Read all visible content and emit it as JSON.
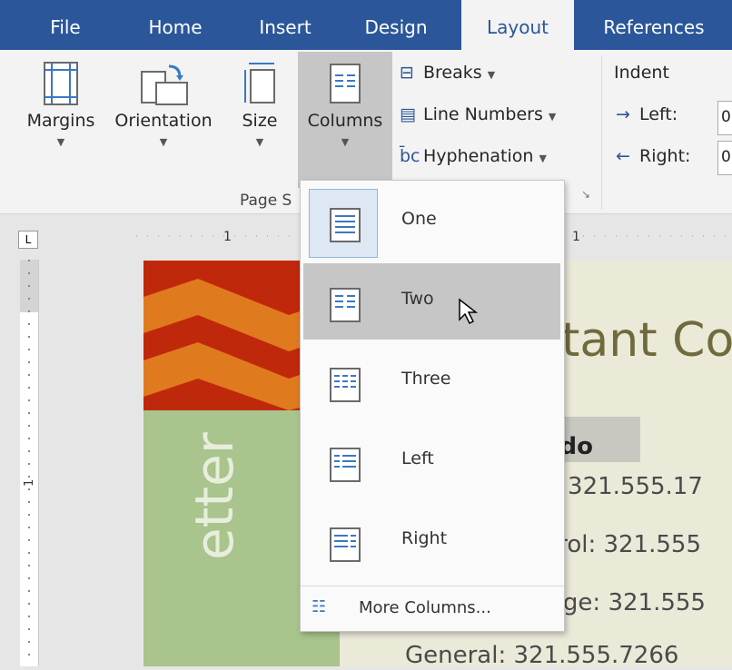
{
  "tabs": [
    "File",
    "Home",
    "Insert",
    "Design",
    "Layout",
    "References"
  ],
  "ribbon": {
    "margins": "Margins",
    "orientation": "Orientation",
    "size": "Size",
    "columns": "Columns",
    "breaks": "Breaks",
    "line_numbers": "Line Numbers",
    "hyphenation": "Hyphenation",
    "group_label": "Page S",
    "indent": "Indent",
    "left": "Left:",
    "right": "Right:",
    "left_value": "0",
    "right_value": "0"
  },
  "columns_menu": {
    "items": [
      "One",
      "Two",
      "Three",
      "Left",
      "Right"
    ],
    "more": "More Columns...",
    "selected": "One",
    "hovered": "Two"
  },
  "ruler": {
    "tab_marker": "L",
    "marks": "1"
  },
  "document": {
    "title_fragment": "tant Co",
    "bold_fragment": "ndo",
    "lines": [
      ": 321.555.17",
      "trol: 321.555",
      "age: 321.555",
      "General: 321.555.7266"
    ],
    "vertical_text": "etter"
  },
  "colors": {
    "tab_bar": "#2b579a",
    "accent": "#2b579a",
    "banner": "#c0280c",
    "sidebar": "#a9c48c"
  }
}
